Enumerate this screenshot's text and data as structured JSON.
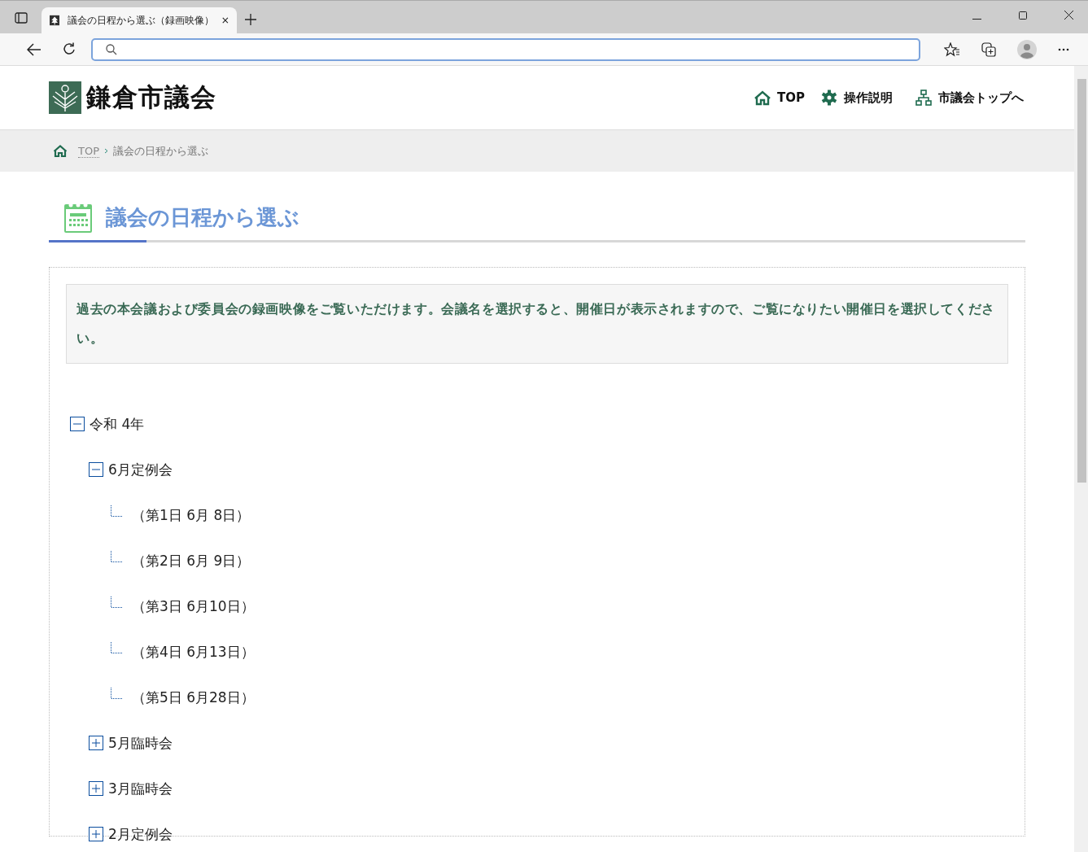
{
  "browser": {
    "tab_title": "議会の日程から選ぶ（録画映像）"
  },
  "site": {
    "logo_text": "鎌倉市議会",
    "nav": [
      {
        "kind": "home",
        "label": "TOP"
      },
      {
        "kind": "gear",
        "label": "操作説明"
      },
      {
        "kind": "sitemap",
        "label": "市議会トップへ"
      }
    ]
  },
  "breadcrumb": [
    {
      "label": "TOP",
      "link": true
    },
    {
      "label": "議会の日程から選ぶ",
      "link": false
    }
  ],
  "page_title": "議会の日程から選ぶ",
  "notice": "過去の本会議および委員会の録画映像をご覧いただけます。会議名を選択すると、開催日が表示されますので、ご覧になりたい開催日を選択してください。",
  "tree": [
    {
      "label": "令和 4年",
      "expanded": true,
      "children": [
        {
          "label": "6月定例会",
          "expanded": true,
          "children": [
            {
              "label": "（第1日 6月 8日）"
            },
            {
              "label": "（第2日 6月 9日）"
            },
            {
              "label": "（第3日 6月10日）"
            },
            {
              "label": "（第4日 6月13日）"
            },
            {
              "label": "（第5日 6月28日）"
            }
          ]
        },
        {
          "label": "5月臨時会",
          "expanded": false
        },
        {
          "label": "3月臨時会",
          "expanded": false
        },
        {
          "label": "2月定例会",
          "expanded": false
        }
      ]
    }
  ]
}
